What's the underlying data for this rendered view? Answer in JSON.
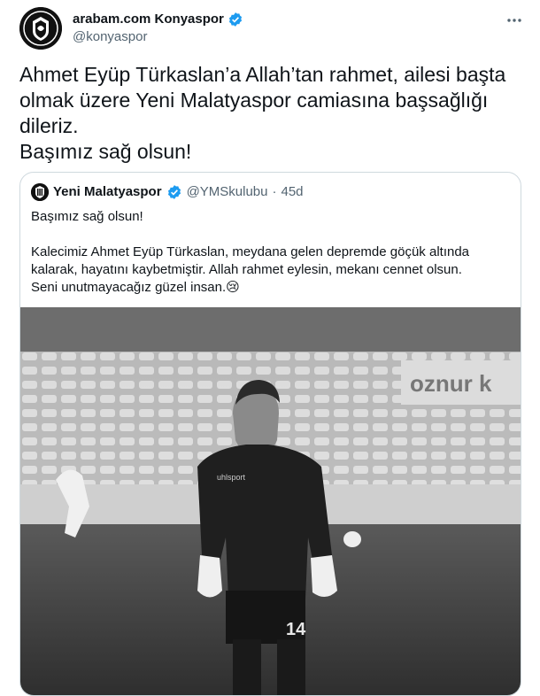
{
  "tweet": {
    "author_name": "arabam.com Konyaspor",
    "author_handle": "@konyaspor",
    "text": "Ahmet Eyüp Türkaslan’a Allah’tan rahmet, ailesi başta olmak üzere Yeni Malatyaspor camiasına başsağlığı dileriz.\nBaşımız sağ olsun!",
    "more_icon": "more-icon"
  },
  "quoted_tweet": {
    "author_name": "Yeni Malatyaspor",
    "author_handle": "@YMSkulubu",
    "separator": "·",
    "timestamp": "45d",
    "text": "Başımız sağ olsun!\n\nKalecimiz Ahmet Eyüp Türkaslan, meydana gelen depremde göçük altında kalarak, hayatını kaybetmiştir. Allah rahmet eylesin, mekanı cennet olsun.\nSeni unutmayacağız güzel insan.😢",
    "photo": {
      "banner_text": "oznur k",
      "jersey_brand": "uhlsport",
      "jersey_number": "14"
    }
  },
  "colors": {
    "verified": "#1d9bf0",
    "text": "#0f1419",
    "secondary_text": "#536471",
    "border": "#cfd9de"
  }
}
